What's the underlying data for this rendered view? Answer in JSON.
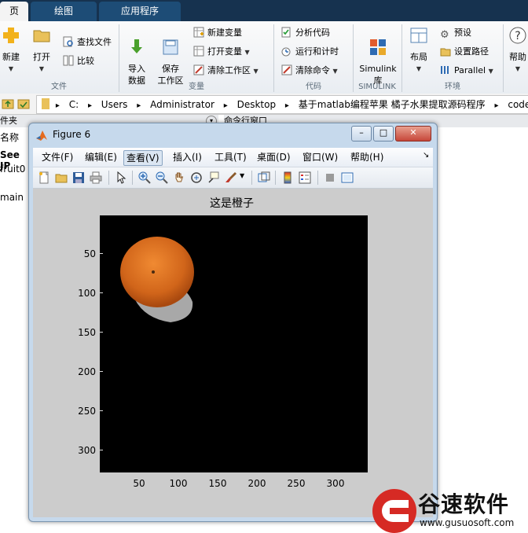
{
  "tabs": [
    "页",
    "绘图",
    "应用程序"
  ],
  "ribbon": {
    "file": {
      "new_label": "新建",
      "open_label": "打开",
      "find_files": "查找文件",
      "compare": "比较",
      "group": "文件"
    },
    "variable": {
      "import_label": "导入\n数据",
      "save_ws": "保存\n工作区",
      "new_var": "新建变量",
      "open_var": "打开变量",
      "clear_ws": "清除工作区",
      "group": "变量"
    },
    "code": {
      "analyze": "分析代码",
      "run_time": "运行和计时",
      "clear_cmd": "清除命令",
      "group": "代码"
    },
    "simulink": {
      "label": "Simulink\n库",
      "group": "SIMULINK"
    },
    "env": {
      "layout": "布局",
      "prefs": "预设",
      "set_path": "设置路径",
      "parallel": "Parallel",
      "group": "环境"
    },
    "help": "帮助"
  },
  "address": {
    "path": [
      "C:",
      "Users",
      "Administrator",
      "Desktop",
      "基于matlab编程苹果 橘子水果提取源码程序",
      "code"
    ]
  },
  "left": {
    "panel_title": "件夹",
    "col_name": "名称",
    "see": "See JP",
    "file1": "fruit0",
    "main": "main"
  },
  "cmd_title": "命令行窗口",
  "figure": {
    "title": "Figure 6",
    "menus": [
      "文件(F)",
      "编辑(E)",
      "查看(V)",
      "插入(I)",
      "工具(T)",
      "桌面(D)",
      "窗口(W)",
      "帮助(H)"
    ],
    "axes_title": "这是橙子",
    "yticks": [
      "50",
      "100",
      "150",
      "200",
      "250",
      "300"
    ],
    "xticks": [
      "50",
      "100",
      "150",
      "200",
      "250",
      "300"
    ]
  },
  "watermark": {
    "text": "谷速软件",
    "url": "www.gusuosoft.com"
  }
}
